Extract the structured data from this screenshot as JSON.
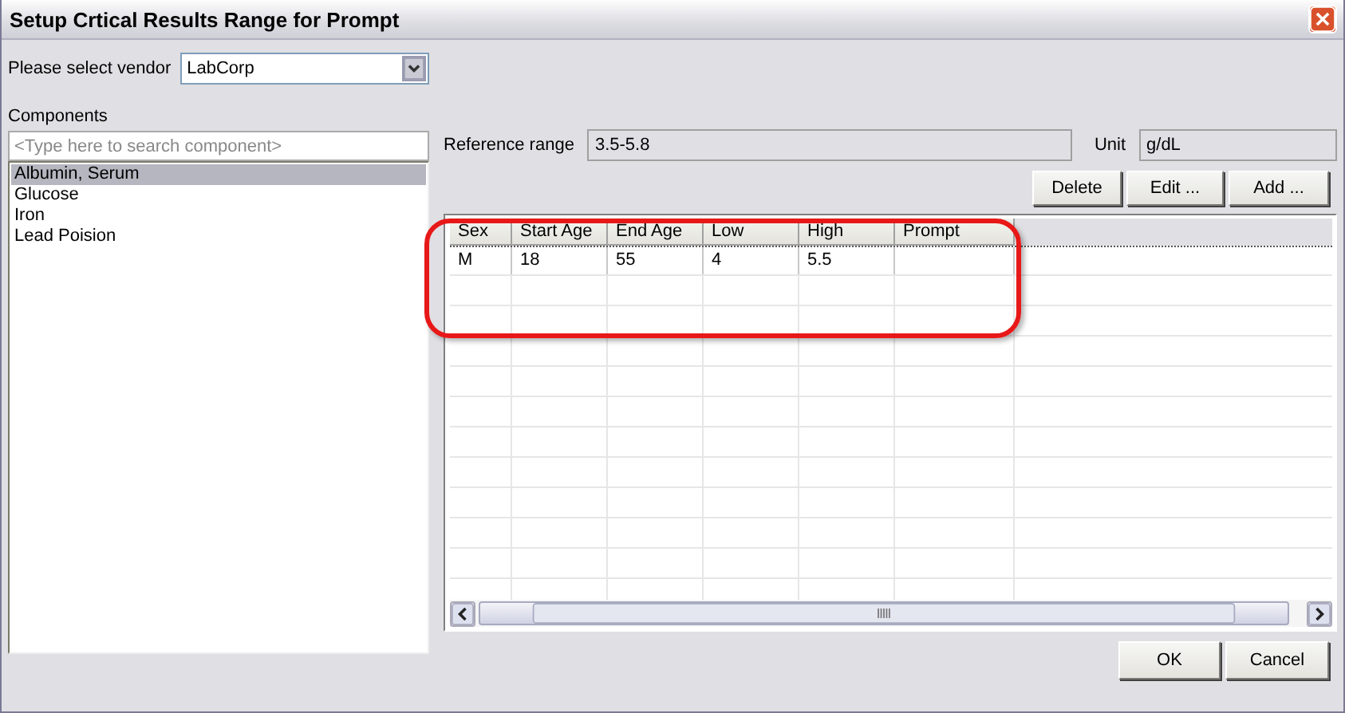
{
  "window": {
    "title": "Setup Crtical Results Range for Prompt"
  },
  "vendor": {
    "label": "Please select vendor",
    "value": "LabCorp"
  },
  "components": {
    "label": "Components",
    "search": {
      "placeholder": "<Type here to search component>"
    },
    "items": [
      {
        "label": "Albumin, Serum",
        "selected": true
      },
      {
        "label": "Glucose",
        "selected": false
      },
      {
        "label": "Iron",
        "selected": false
      },
      {
        "label": "Lead Poision",
        "selected": false
      }
    ]
  },
  "reference_range": {
    "label": "Reference range",
    "value": "3.5-5.8"
  },
  "unit": {
    "label": "Unit",
    "value": "g/dL"
  },
  "grid_buttons": [
    "Delete",
    "Edit ...",
    "Add ..."
  ],
  "table": {
    "columns": [
      "Sex",
      "Start Age",
      "End Age",
      "Low",
      "High",
      "Prompt"
    ],
    "rows": [
      [
        "M",
        "18",
        "55",
        "4",
        "5.5",
        ""
      ]
    ]
  },
  "highlight": {
    "shown": true
  },
  "buttons": [
    "OK",
    "Cancel"
  ]
}
